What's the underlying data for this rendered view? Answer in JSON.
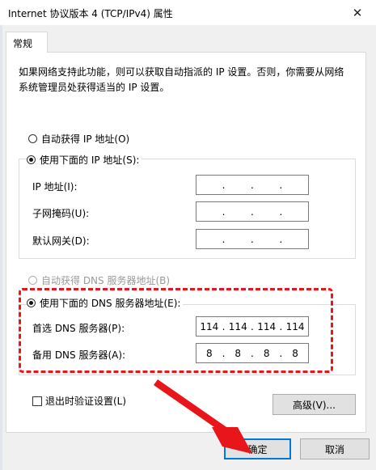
{
  "window": {
    "title": "Internet 协议版本 4 (TCP/IPv4) 属性",
    "close_glyph": "✕"
  },
  "tabs": [
    {
      "label": "常规",
      "selected": true
    }
  ],
  "description": "如果网络支持此功能，则可以获取自动指派的 IP 设置。否则，你需要从网络系统管理员处获得适当的 IP 设置。",
  "ip_section": {
    "auto_label": "自动获得 IP 地址(O)",
    "manual_label": "使用下面的 IP 地址(S):",
    "selected": "manual",
    "fields": [
      {
        "label": "IP 地址(I):",
        "octets": [
          "",
          "",
          "",
          ""
        ]
      },
      {
        "label": "子网掩码(U):",
        "octets": [
          "",
          "",
          "",
          ""
        ]
      },
      {
        "label": "默认网关(D):",
        "octets": [
          "",
          "",
          "",
          ""
        ]
      }
    ]
  },
  "dns_section": {
    "auto_label": "自动获得 DNS 服务器地址(B)",
    "auto_disabled": true,
    "manual_label": "使用下面的 DNS 服务器地址(E):",
    "selected": "manual",
    "fields": [
      {
        "label": "首选 DNS 服务器(P):",
        "octets": [
          "114",
          "114",
          "114",
          "114"
        ]
      },
      {
        "label": "备用 DNS 服务器(A):",
        "octets": [
          "8",
          "8",
          "8",
          "8"
        ]
      }
    ]
  },
  "validate_on_exit": {
    "label": "退出时验证设置(L)",
    "checked": false
  },
  "buttons": {
    "advanced": "高级(V)...",
    "ok": "确定",
    "cancel": "取消"
  },
  "colors": {
    "highlight_red": "#e8161b",
    "focus_blue": "#0078d7"
  }
}
